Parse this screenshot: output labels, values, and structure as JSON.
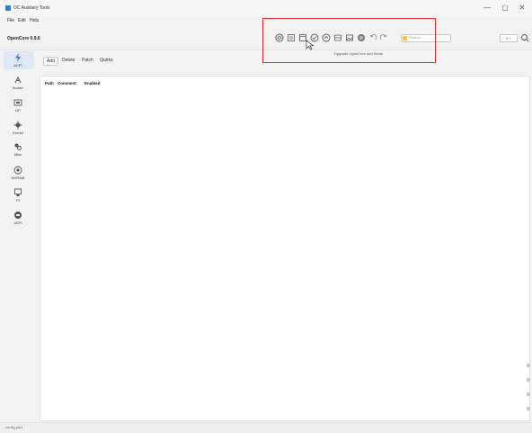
{
  "window": {
    "title": "OC Auxiliary Tools",
    "minimize_glyph": "—",
    "maximize_glyph": "▢",
    "close_glyph": "✕"
  },
  "menu": {
    "items": [
      "File",
      "Edit",
      "Help"
    ]
  },
  "header": {
    "version": "OpenCore 0.9.6",
    "toolbar_icons": [
      "search-circle-icon",
      "list-icon",
      "document-icon",
      "check-circle-icon",
      "upgrade-icon",
      "database-icon",
      "image-icon",
      "globe-icon",
      "undo-icon",
      "redo-icon"
    ],
    "search_placeholder": "Search",
    "tooltip": "Upgrade OpenCore and Kexts",
    "right_control": "0 ÷",
    "highlight_color": "#e03030"
  },
  "sidebar": {
    "items": [
      {
        "label": "ACPI",
        "icon": "acpi-icon"
      },
      {
        "label": "Booter",
        "icon": "booter-icon"
      },
      {
        "label": "DP",
        "icon": "device-properties-icon"
      },
      {
        "label": "Kernel",
        "icon": "kernel-icon"
      },
      {
        "label": "Misc",
        "icon": "misc-icon"
      },
      {
        "label": "NVRAM",
        "icon": "nvram-icon"
      },
      {
        "label": "PI",
        "icon": "platform-info-icon"
      },
      {
        "label": "UEFI",
        "icon": "uefi-icon"
      }
    ],
    "accent": "#2a7fd6"
  },
  "tabs": [
    "Add",
    "Delete",
    "Patch",
    "Quirks"
  ],
  "table": {
    "columns": [
      "Path",
      "Comment",
      "Enabled"
    ]
  },
  "status": {
    "text": "config.plist"
  }
}
